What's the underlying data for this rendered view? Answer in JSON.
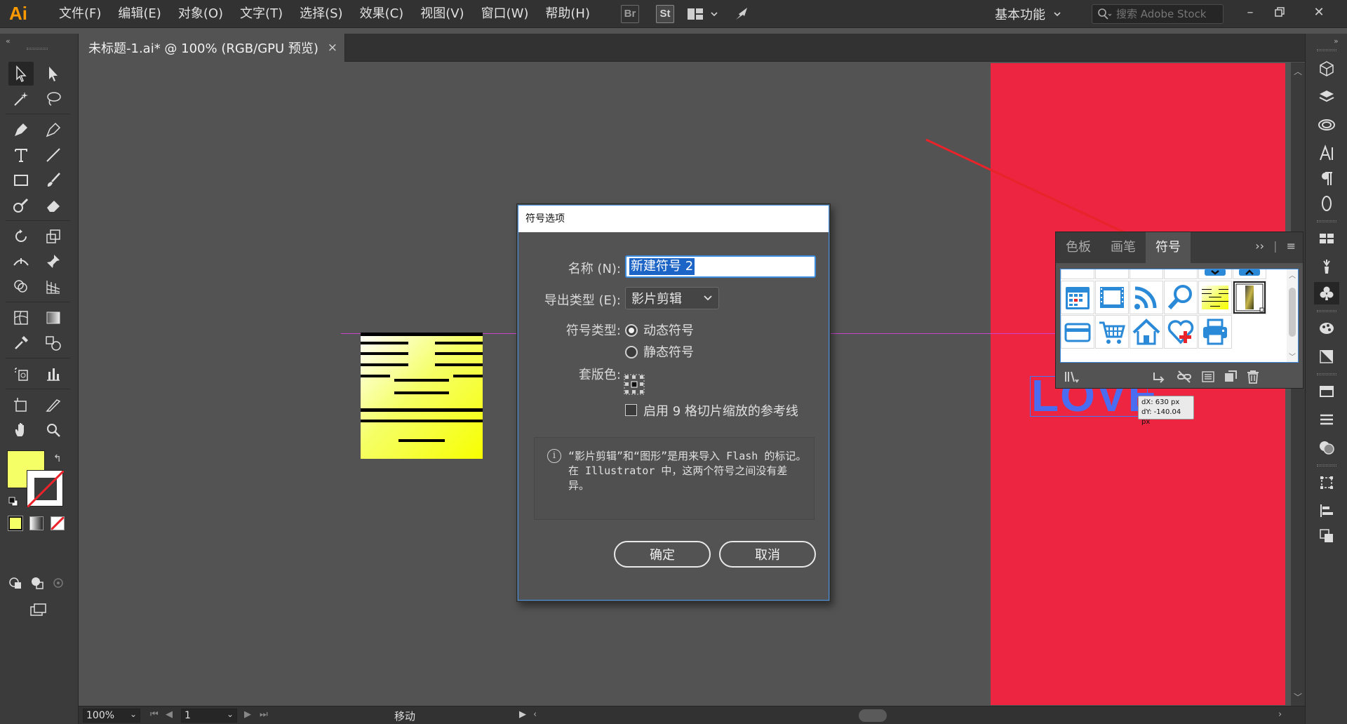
{
  "app": {
    "logo": "Ai",
    "accent": "#ff9a00"
  },
  "menu": [
    "文件(F)",
    "编辑(E)",
    "对象(O)",
    "文字(T)",
    "选择(S)",
    "效果(C)",
    "视图(V)",
    "窗口(W)",
    "帮助(H)"
  ],
  "app_buttons": {
    "bridge": "Br",
    "stock": "St"
  },
  "workspace": {
    "label": "基本功能"
  },
  "search": {
    "placeholder": "搜索 Adobe Stock"
  },
  "window_controls": [
    "minimize-icon",
    "restore-icon",
    "close-icon"
  ],
  "document_tab": {
    "title": "未标题-1.ai* @ 100% (RGB/GPU 预览)",
    "close": "×"
  },
  "colors": {
    "fill": "#f5ff66",
    "artboard": "#ee2540",
    "love_text": "#4a6cf0",
    "selection": "#3d8ee0",
    "guide": "#cc44cc"
  },
  "artwork": {
    "love_text": "LOVE",
    "glyph": "喜"
  },
  "measure_tip": {
    "dx": "dX: 630 px",
    "dy": "dY: -140.04 px"
  },
  "status_bar": {
    "zoom": "100%",
    "artboard": "1",
    "tool": "移动"
  },
  "dialog": {
    "title": "符号选项",
    "name_label": "名称 (N):",
    "name_value": "新建符号 2",
    "export_label": "导出类型 (E):",
    "export_value": "影片剪辑",
    "symbol_type_label": "符号类型:",
    "dynamic_label": "动态符号",
    "static_label": "静态符号",
    "selected_type": "动态符号",
    "registration_label": "套版色:",
    "nine_slice_label": "启用 9 格切片缩放的参考线",
    "nine_slice_checked": false,
    "info_icon": "info-icon",
    "info_text": "“影片剪辑”和“图形”是用来导入 Flash 的标记。在 Illustrator 中，这两个符号之间没有差异。",
    "ok_label": "确定",
    "cancel_label": "取消"
  },
  "symbols_panel": {
    "tabs": [
      "色板",
      "画笔",
      "符号"
    ],
    "active_tab": "符号",
    "expand": "››",
    "symbols_row2": [
      "calendar-icon",
      "film-icon",
      "rss-icon",
      "search-icon",
      "xi-symbol",
      "new-symbol"
    ],
    "symbols_row3": [
      "credit-card-icon",
      "cart-icon",
      "home-icon",
      "heart-plus-icon",
      "printer-icon"
    ],
    "footer_icons": [
      "symbol-library-icon",
      "place-symbol-icon",
      "break-link-icon",
      "symbol-options-icon",
      "new-symbol-icon",
      "delete-icon"
    ]
  }
}
